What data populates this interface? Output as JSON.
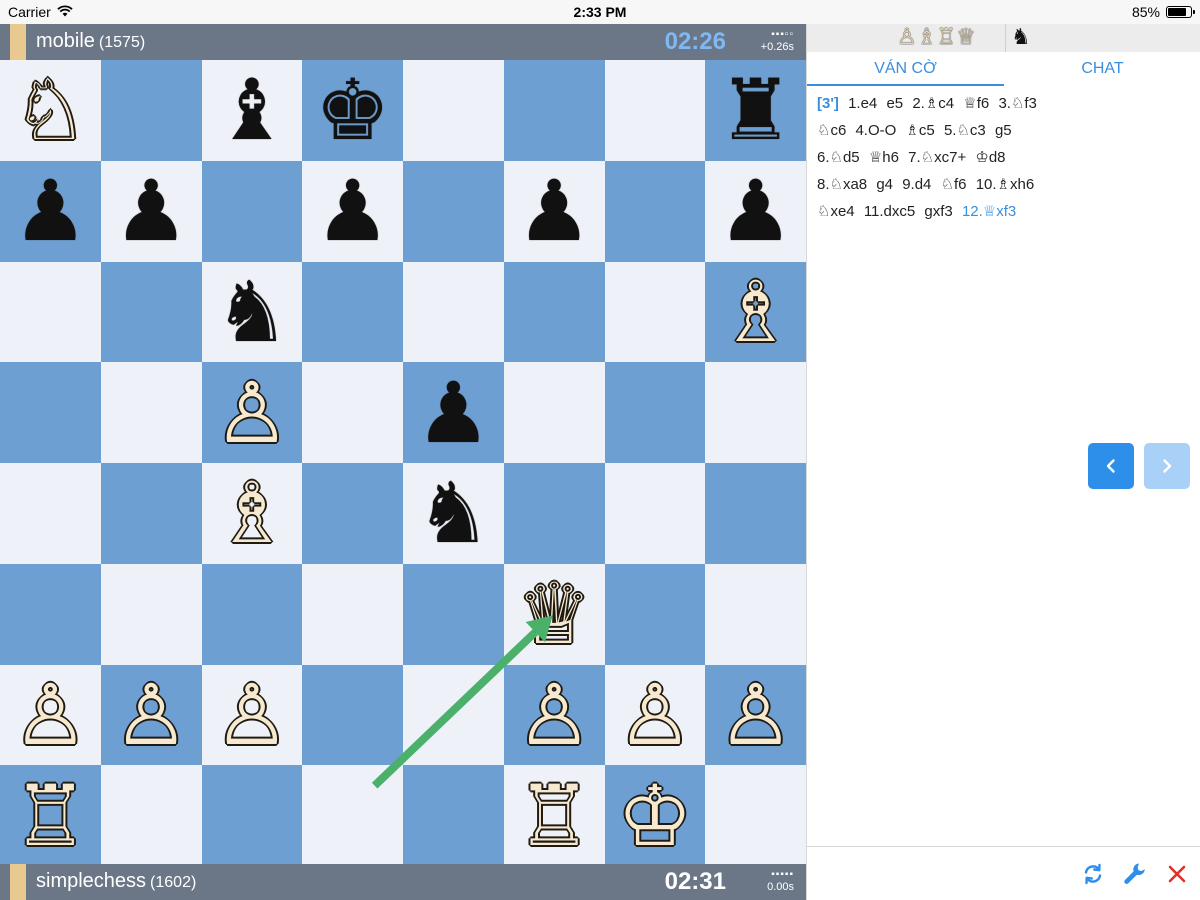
{
  "status_bar": {
    "carrier": "Carrier",
    "time": "2:33 PM",
    "battery": "85%",
    "battery_level": 0.85
  },
  "top_player": {
    "name": "mobile",
    "rating": "(1575)",
    "clock": "02:26",
    "lag": "+0.26s",
    "side": "black",
    "clock_active": true
  },
  "bottom_player": {
    "name": "simplechess",
    "rating": "(1602)",
    "clock": "02:31",
    "lag": "0.00s",
    "side": "white",
    "clock_active": false
  },
  "board": {
    "light_color": "#eef1f7",
    "dark_color": "#6d9fd3",
    "pieces": [
      {
        "square": "a8",
        "color": "w",
        "type": "N"
      },
      {
        "square": "c8",
        "color": "b",
        "type": "B"
      },
      {
        "square": "d8",
        "color": "b",
        "type": "K"
      },
      {
        "square": "h8",
        "color": "b",
        "type": "R"
      },
      {
        "square": "a7",
        "color": "b",
        "type": "P"
      },
      {
        "square": "b7",
        "color": "b",
        "type": "P"
      },
      {
        "square": "d7",
        "color": "b",
        "type": "P"
      },
      {
        "square": "f7",
        "color": "b",
        "type": "P"
      },
      {
        "square": "h7",
        "color": "b",
        "type": "P"
      },
      {
        "square": "c6",
        "color": "b",
        "type": "N"
      },
      {
        "square": "h6",
        "color": "w",
        "type": "B"
      },
      {
        "square": "c5",
        "color": "w",
        "type": "P"
      },
      {
        "square": "e5",
        "color": "b",
        "type": "P"
      },
      {
        "square": "c4",
        "color": "w",
        "type": "B"
      },
      {
        "square": "e4",
        "color": "b",
        "type": "N"
      },
      {
        "square": "f3",
        "color": "w",
        "type": "Q"
      },
      {
        "square": "a2",
        "color": "w",
        "type": "P"
      },
      {
        "square": "b2",
        "color": "w",
        "type": "P"
      },
      {
        "square": "c2",
        "color": "w",
        "type": "P"
      },
      {
        "square": "f2",
        "color": "w",
        "type": "P"
      },
      {
        "square": "g2",
        "color": "w",
        "type": "P"
      },
      {
        "square": "h2",
        "color": "w",
        "type": "P"
      },
      {
        "square": "a1",
        "color": "w",
        "type": "R"
      },
      {
        "square": "f1",
        "color": "w",
        "type": "R"
      },
      {
        "square": "g1",
        "color": "w",
        "type": "K"
      }
    ],
    "arrow": {
      "from": "d1",
      "to": "f3",
      "color": "#4ab06a"
    }
  },
  "material": {
    "white": "♙♗♖♕",
    "black": "♞"
  },
  "tabs": [
    {
      "label": "VÁN CỜ",
      "active": true
    },
    {
      "label": "CHAT",
      "active": false
    }
  ],
  "moves": {
    "time_control": "[3']",
    "list": [
      "1.e4",
      "e5",
      "2.♗c4",
      "♕f6",
      "3.♘f3",
      "♘c6",
      "4.O-O",
      "♗c5",
      "5.♘c3",
      "g5",
      "6.♘d5",
      "♕h6",
      "7.♘xc7+",
      "♔d8",
      "8.♘xa8",
      "g4",
      "9.d4",
      "♘f6",
      "10.♗xh6",
      "♘xe4",
      "11.dxc5",
      "gxf3",
      "12.♕xf3"
    ],
    "current_index": 22
  },
  "icons": {
    "prev": "chevron-left-icon",
    "next": "chevron-right-icon",
    "flip": "refresh-icon",
    "settings": "wrench-icon",
    "close": "close-icon"
  },
  "colors": {
    "accent": "#3a8ee0",
    "player_bar": "#6b7687",
    "close": "#e0302a"
  }
}
